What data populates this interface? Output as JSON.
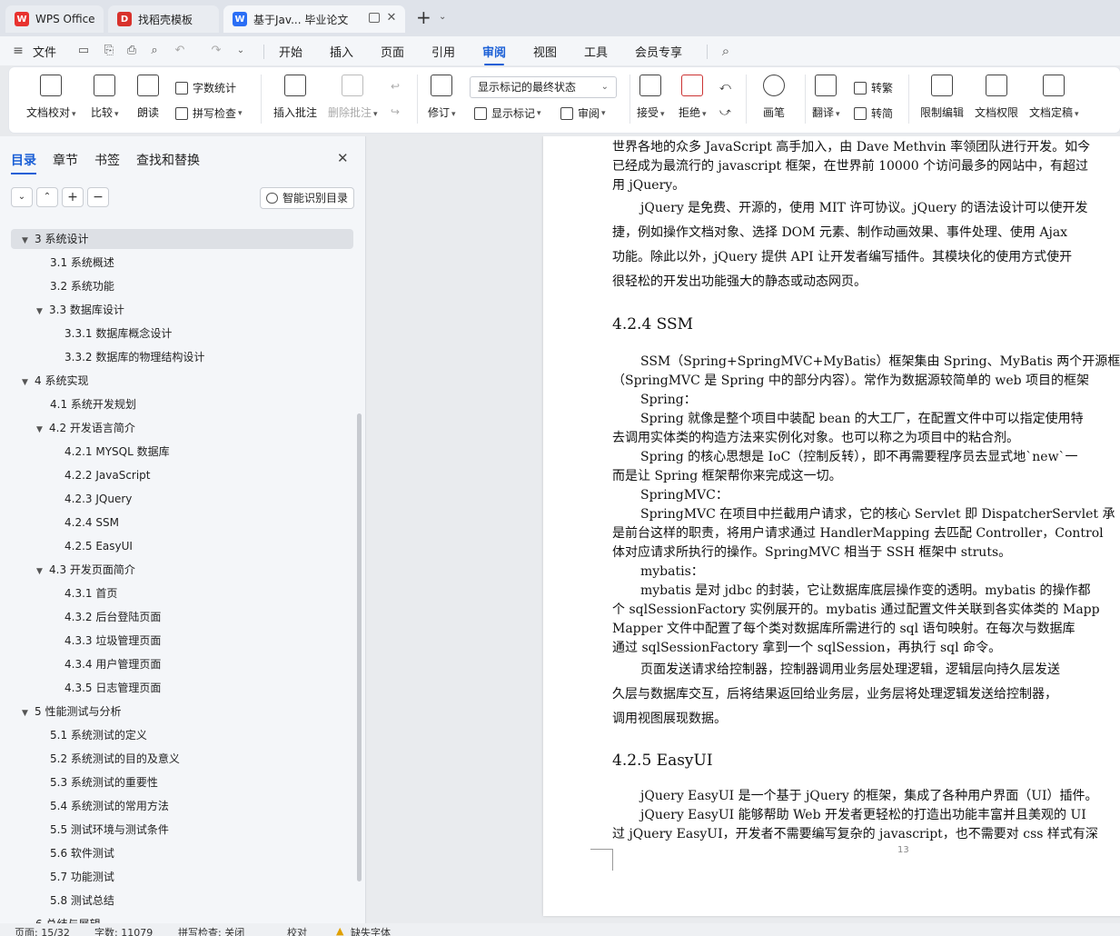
{
  "tabs": [
    {
      "label": "WPS Office",
      "icon": "wps-logo-icon"
    },
    {
      "label": "找稻壳模板",
      "icon": "docer-icon"
    },
    {
      "label": "基于Jav... 毕业论文",
      "icon": "word-doc-icon"
    }
  ],
  "colors": {
    "accent": "#1a5fd6",
    "wps_red": "#e8322f",
    "docer_red": "#d8322c",
    "word_blue": "#2a6ef5"
  },
  "menu": {
    "file": "文件",
    "items": [
      "开始",
      "插入",
      "页面",
      "引用",
      "审阅",
      "视图",
      "工具",
      "会员专享"
    ],
    "active": "审阅"
  },
  "ribbon": {
    "doc_proofread": "文档校对",
    "compare": "比较",
    "read_aloud": "朗读",
    "word_count": "字数统计",
    "spell_check": "拼写检查",
    "insert_comment": "插入批注",
    "delete_comment": "删除批注",
    "revise": "修订",
    "markup_state": "显示标记的最终状态",
    "show_markup": "显示标记",
    "review": "审阅",
    "accept": "接受",
    "reject": "拒绝",
    "brush": "画笔",
    "translate": "翻译",
    "to_traditional": "转繁",
    "to_simplified": "转简",
    "restrict_edit": "限制编辑",
    "doc_permission": "文档权限",
    "doc_finalize": "文档定稿"
  },
  "nav": {
    "tabs": [
      "目录",
      "章节",
      "书签",
      "查找和替换"
    ],
    "smart_button": "智能识别目录",
    "toc": [
      {
        "text": "3  系统设计",
        "level": 1,
        "expanded": true,
        "selected": true
      },
      {
        "text": "3.1  系统概述",
        "level": 2
      },
      {
        "text": "3.2  系统功能",
        "level": 2
      },
      {
        "text": "3.3  数据库设计",
        "level": 2,
        "expanded": true
      },
      {
        "text": "3.3.1 数据库概念设计",
        "level": 3
      },
      {
        "text": "3.3.2 数据库的物理结构设计",
        "level": 3
      },
      {
        "text": "4  系统实现",
        "level": 1,
        "expanded": true
      },
      {
        "text": "4.1  系统开发规划",
        "level": 2
      },
      {
        "text": "4.2  开发语言简介",
        "level": 2,
        "expanded": true
      },
      {
        "text": "4.2.1 MYSQL 数据库",
        "level": 3
      },
      {
        "text": "4.2.2 JavaScript",
        "level": 3
      },
      {
        "text": "4.2.3 JQuery",
        "level": 3
      },
      {
        "text": "4.2.4 SSM",
        "level": 3
      },
      {
        "text": "4.2.5 EasyUI",
        "level": 3
      },
      {
        "text": "4.3  开发页面简介",
        "level": 2,
        "expanded": true
      },
      {
        "text": "4.3.1 首页",
        "level": 3
      },
      {
        "text": "4.3.2 后台登陆页面",
        "level": 3
      },
      {
        "text": "4.3.3 垃圾管理页面",
        "level": 3
      },
      {
        "text": "4.3.4 用户管理页面",
        "level": 3
      },
      {
        "text": "4.3.5 日志管理页面",
        "level": 3
      },
      {
        "text": "5  性能测试与分析",
        "level": 1,
        "expanded": true
      },
      {
        "text": "5.1  系统测试的定义",
        "level": 2
      },
      {
        "text": "5.2  系统测试的目的及意义",
        "level": 2
      },
      {
        "text": "5.3  系统测试的重要性",
        "level": 2
      },
      {
        "text": "5.4  系统测试的常用方法",
        "level": 2
      },
      {
        "text": "5.5  测试环境与测试条件",
        "level": 2
      },
      {
        "text": "5.6  软件测试",
        "level": 2
      },
      {
        "text": "5.7  功能测试",
        "level": 2
      },
      {
        "text": "5.8  测试总结",
        "level": 2
      },
      {
        "text": "6  总结与展望",
        "level": 1
      }
    ]
  },
  "document": {
    "lines": [
      {
        "text": "世界各地的众多 JavaScript 高手加入，由 Dave Methvin 率领团队进行开发。如今",
        "kind": "body"
      },
      {
        "text": "已经成为最流行的 javascript 框架，在世界前 10000 个访问最多的网站中，有超过",
        "kind": "body"
      },
      {
        "text": "用 jQuery。",
        "kind": "body"
      },
      {
        "text": "jQuery 是免费、开源的，使用 MIT 许可协议。jQuery 的语法设计可以使开发",
        "kind": "indent"
      },
      {
        "text": "捷，例如操作文档对象、选择 DOM 元素、制作动画效果、事件处理、使用 Ajax",
        "kind": "body"
      },
      {
        "text": "功能。除此以外，jQuery 提供 API 让开发者编写插件。其模块化的使用方式使开",
        "kind": "body"
      },
      {
        "text": "很轻松的开发出功能强大的静态或动态网页。",
        "kind": "body"
      },
      {
        "text": "4.2.4 SSM",
        "kind": "heading"
      },
      {
        "text": "SSM（Spring+SpringMVC+MyBatis）框架集由 Spring、MyBatis 两个开源框架",
        "kind": "indent"
      },
      {
        "text": "（SpringMVC 是 Spring 中的部分内容）。常作为数据源较简单的 web 项目的框架",
        "kind": "body"
      },
      {
        "text": "Spring：",
        "kind": "indent"
      },
      {
        "text": "Spring 就像是整个项目中装配 bean 的大工厂，在配置文件中可以指定使用特",
        "kind": "indent"
      },
      {
        "text": "去调用实体类的构造方法来实例化对象。也可以称之为项目中的粘合剂。",
        "kind": "body"
      },
      {
        "text": "Spring 的核心思想是 IoC（控制反转），即不再需要程序员去显式地`new`一",
        "kind": "indent"
      },
      {
        "text": "而是让 Spring 框架帮你来完成这一切。",
        "kind": "body"
      },
      {
        "text": "SpringMVC：",
        "kind": "indent"
      },
      {
        "text": "SpringMVC 在项目中拦截用户请求，它的核心 Servlet 即 DispatcherServlet 承",
        "kind": "indent"
      },
      {
        "text": "是前台这样的职责，将用户请求通过 HandlerMapping 去匹配 Controller，Control",
        "kind": "body"
      },
      {
        "text": "体对应请求所执行的操作。SpringMVC 相当于 SSH 框架中 struts。",
        "kind": "body"
      },
      {
        "text": "mybatis：",
        "kind": "indent"
      },
      {
        "text": "mybatis 是对 jdbc 的封装，它让数据库底层操作变的透明。mybatis 的操作都",
        "kind": "indent"
      },
      {
        "text": "个 sqlSessionFactory 实例展开的。mybatis 通过配置文件关联到各实体类的 Mapp",
        "kind": "body"
      },
      {
        "text": "Mapper 文件中配置了每个类对数据库所需进行的 sql 语句映射。在每次与数据库",
        "kind": "body"
      },
      {
        "text": "通过 sqlSessionFactory 拿到一个 sqlSession，再执行 sql 命令。",
        "kind": "body"
      },
      {
        "text": "页面发送请求给控制器，控制器调用业务层处理逻辑，逻辑层向持久层发送",
        "kind": "indent"
      },
      {
        "text": "久层与数据库交互，后将结果返回给业务层，业务层将处理逻辑发送给控制器，",
        "kind": "body"
      },
      {
        "text": "调用视图展现数据。",
        "kind": "body"
      },
      {
        "text": "4.2.5 EasyUI",
        "kind": "heading"
      },
      {
        "text": "jQuery EasyUI 是一个基于 jQuery 的框架，集成了各种用户界面（UI）插件。",
        "kind": "indent"
      },
      {
        "text": "jQuery EasyUI 能够帮助 Web 开发者更轻松的打造出功能丰富并且美观的 UI",
        "kind": "indent"
      },
      {
        "text": "过 jQuery EasyUI，开发者不需要编写复杂的 javascript，也不需要对 css 样式有深",
        "kind": "body"
      }
    ],
    "page_number": "13"
  },
  "status": {
    "page": "页面: 15/32",
    "words": "字数: 11079",
    "spell": "拼写检查: 关闭",
    "proof": "校对",
    "missing_font": "缺失字体"
  }
}
